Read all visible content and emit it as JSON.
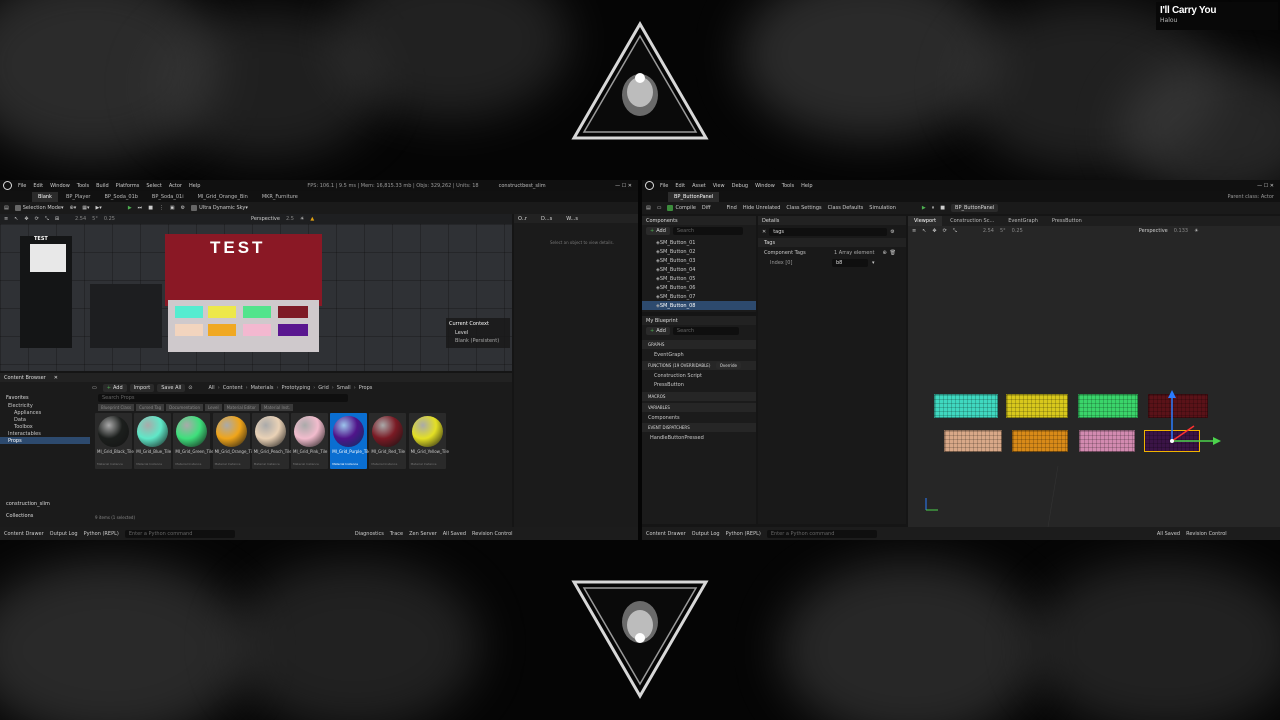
{
  "now_playing": {
    "title": "I'll Carry You",
    "artist": "Halou"
  },
  "left_editor": {
    "menu": [
      "File",
      "Edit",
      "Window",
      "Tools",
      "Build",
      "Platforms",
      "Select",
      "Actor",
      "Help"
    ],
    "stats": "FPS: 106.1  |  9.5 ms  |  Mem: 16,815.33 mb  |  Objs: 329,262  |  Units: 18",
    "project": "constructbest_slim",
    "tabs": [
      "Blank",
      "BP_Player",
      "BP_Soda_01b",
      "BP_Soda_01i",
      "MI_Grid_Orange_Bin",
      "MKR_Furniture"
    ],
    "toolbar": {
      "mode": "Selection Mode",
      "dynamic_sky": "Ultra Dynamic Sky"
    },
    "viewport": {
      "perspective": "Perspective",
      "cam_speed": "2.5",
      "snap_values": [
        "2.54",
        "5°",
        "0.25"
      ],
      "sign_big": "TEST",
      "sign_small": "TEST",
      "current_context_label": "Current Context",
      "level_label": "Level",
      "level_value": "Blank (Persistent)"
    },
    "outliner_tabs": [
      "O..r",
      "D...s",
      "W...s"
    ],
    "outliner_hint": "Select an object to view details.",
    "content_browser": {
      "title": "Content Browser",
      "add": "Add",
      "import": "Import",
      "save_all": "Save All",
      "breadcrumb": [
        "All",
        "Content",
        "Materials",
        "Prototyping",
        "Grid",
        "Small",
        "Props"
      ],
      "search_placeholder": "Search Props",
      "filters": [
        "Blueprint Class",
        "Cursed Tag",
        "Documentation",
        "Level",
        "Material Editor",
        "Material Inst."
      ],
      "favorites_label": "Favorites",
      "folders": [
        "Electricity",
        "Appliances",
        "Data",
        "Toolbox",
        "Interactables",
        "Props"
      ],
      "bottom_items": [
        "construction_slim",
        "Collections"
      ],
      "status": "9 items (1 selected)",
      "assets": [
        {
          "name": "MI_Grid_Black_Tile",
          "type": "Material Instance",
          "color": "#1c1f1d"
        },
        {
          "name": "MI_Grid_Blue_Tile",
          "type": "Material Instance",
          "color": "#5fe8c8"
        },
        {
          "name": "MI_Grid_Green_Tile",
          "type": "Material Instance",
          "color": "#3ee07c"
        },
        {
          "name": "MI_Grid_Orange_Tile",
          "type": "Material Instance",
          "color": "#f0a51a"
        },
        {
          "name": "MI_Grid_Peach_Tile",
          "type": "Material Instance",
          "color": "#ead2b6"
        },
        {
          "name": "MI_Grid_Pink_Tile",
          "type": "Material Instance",
          "color": "#f2bccd"
        },
        {
          "name": "MI_Grid_Purple_Tile",
          "type": "Material Instance",
          "color": "#50148a"
        },
        {
          "name": "MI_Grid_Red_Tile",
          "type": "Material Instance",
          "color": "#7a1a24"
        },
        {
          "name": "MI_Grid_Yellow_Tile",
          "type": "Material Instance",
          "color": "#e4e024"
        }
      ],
      "selected_index": 6
    },
    "statusbar": {
      "content_drawer": "Content Drawer",
      "output_log": "Output Log",
      "cmd": "Python (REPL)",
      "cmd_placeholder": "Enter a Python command",
      "diagnostics": "Diagnostics",
      "trace": "Trace",
      "zen": "Zen Server",
      "save": "All Saved",
      "revision": "Revision Control"
    }
  },
  "right_editor": {
    "menu": [
      "File",
      "Edit",
      "Asset",
      "View",
      "Debug",
      "Window",
      "Tools",
      "Help"
    ],
    "tab": "BP_ButtonPanel",
    "parent_class": "Parent class: Actor",
    "toolbar": {
      "compile": "Compile",
      "diff": "Diff",
      "find": "Find",
      "hide_unrelated": "Hide Unrelated",
      "class_settings": "Class Settings",
      "class_defaults": "Class Defaults",
      "simulation": "Simulation",
      "debug_object": "BP_ButtonPanel"
    },
    "components": {
      "title": "Components",
      "add": "Add",
      "search": "Search",
      "items": [
        "SM_Button_01",
        "SM_Button_02",
        "SM_Button_03",
        "SM_Button_04",
        "SM_Button_05",
        "SM_Button_06",
        "SM_Button_07",
        "SM_Button_08"
      ],
      "selected": 7
    },
    "details": {
      "title": "Details",
      "search_value": "tags",
      "section": "Tags",
      "prop_label": "Component Tags",
      "prop_value": "1 Array element",
      "index_label": "Index [0]",
      "index_value": "b8"
    },
    "my_blueprint": {
      "title": "My Blueprint",
      "add": "Add",
      "search": "Search",
      "graphs_label": "GRAPHS",
      "event_graph": "EventGraph",
      "functions_label": "FUNCTIONS (19 OVERRIDABLE)",
      "override": "Override",
      "functions": [
        "Construction Script",
        "PressButton"
      ],
      "macros": "MACROS",
      "variables": "VARIABLES",
      "components": "Components",
      "dispatchers_label": "EVENT DISPATCHERS",
      "dispatchers": [
        "HandleButtonPressed"
      ]
    },
    "graph_tabs": [
      "Viewport",
      "Construction Sc...",
      "EventGraph",
      "PressButton"
    ],
    "viewport": {
      "perspective": "Perspective",
      "speed": "0.133",
      "snap_values": [
        "2.54",
        "5°",
        "0.25"
      ]
    },
    "buttons": [
      {
        "color": "#3fd8c0"
      },
      {
        "color": "#d8c81c"
      },
      {
        "color": "#3ad46a"
      },
      {
        "color": "#5a1218"
      },
      {
        "color": "#d8a888"
      },
      {
        "color": "#d88a18"
      },
      {
        "color": "#d28ab0"
      },
      {
        "color": "#3a1446"
      }
    ],
    "statusbar": {
      "content_drawer": "Content Drawer",
      "output_log": "Output Log",
      "cmd": "Python (REPL)",
      "cmd_placeholder": "Enter a Python command",
      "save": "All Saved",
      "revision": "Revision Control"
    }
  }
}
